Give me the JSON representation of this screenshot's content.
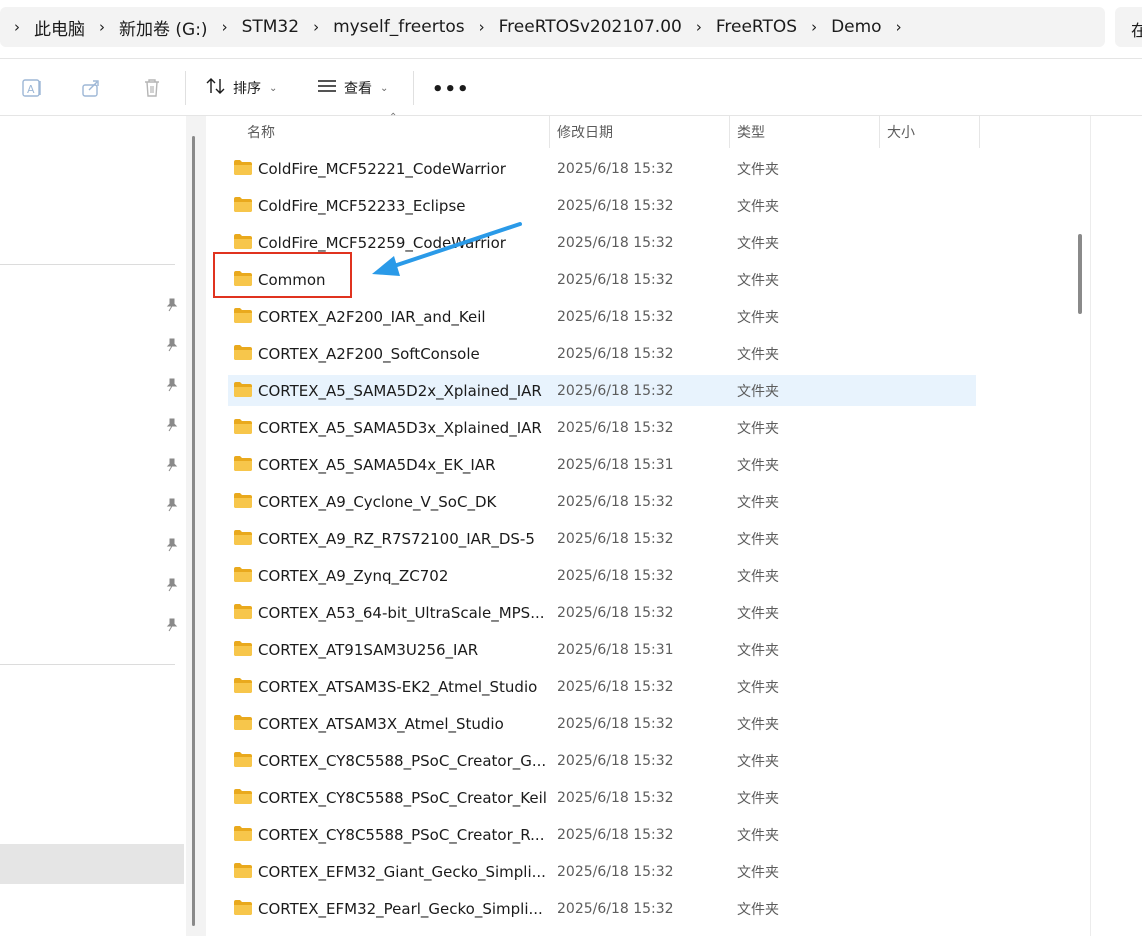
{
  "breadcrumb": {
    "items": [
      "此电脑",
      "新加卷 (G:)",
      "STM32",
      "myself_freertos",
      "FreeRTOSv202107.00",
      "FreeRTOS",
      "Demo"
    ],
    "search_stub": "在"
  },
  "toolbar": {
    "sort_label": "排序",
    "view_label": "查看",
    "more_label": "•••"
  },
  "columns": {
    "name": "名称",
    "date": "修改日期",
    "type": "类型",
    "size": "大小"
  },
  "colors": {
    "selection": "#e8f3fd",
    "highlight": "#e0331f",
    "arrow": "#2a9ae8",
    "folder": "#f7c64b"
  },
  "files": [
    {
      "name": "ColdFire_MCF52221_CodeWarrior",
      "date": "2025/6/18 15:32",
      "type": "文件夹"
    },
    {
      "name": "ColdFire_MCF52233_Eclipse",
      "date": "2025/6/18 15:32",
      "type": "文件夹"
    },
    {
      "name": "ColdFire_MCF52259_CodeWarrior",
      "date": "2025/6/18 15:32",
      "type": "文件夹"
    },
    {
      "name": "Common",
      "date": "2025/6/18 15:32",
      "type": "文件夹"
    },
    {
      "name": "CORTEX_A2F200_IAR_and_Keil",
      "date": "2025/6/18 15:32",
      "type": "文件夹"
    },
    {
      "name": "CORTEX_A2F200_SoftConsole",
      "date": "2025/6/18 15:32",
      "type": "文件夹"
    },
    {
      "name": "CORTEX_A5_SAMA5D2x_Xplained_IAR",
      "date": "2025/6/18 15:32",
      "type": "文件夹"
    },
    {
      "name": "CORTEX_A5_SAMA5D3x_Xplained_IAR",
      "date": "2025/6/18 15:32",
      "type": "文件夹"
    },
    {
      "name": "CORTEX_A5_SAMA5D4x_EK_IAR",
      "date": "2025/6/18 15:31",
      "type": "文件夹"
    },
    {
      "name": "CORTEX_A9_Cyclone_V_SoC_DK",
      "date": "2025/6/18 15:32",
      "type": "文件夹"
    },
    {
      "name": "CORTEX_A9_RZ_R7S72100_IAR_DS-5",
      "date": "2025/6/18 15:32",
      "type": "文件夹"
    },
    {
      "name": "CORTEX_A9_Zynq_ZC702",
      "date": "2025/6/18 15:32",
      "type": "文件夹"
    },
    {
      "name": "CORTEX_A53_64-bit_UltraScale_MPS...",
      "date": "2025/6/18 15:32",
      "type": "文件夹"
    },
    {
      "name": "CORTEX_AT91SAM3U256_IAR",
      "date": "2025/6/18 15:31",
      "type": "文件夹"
    },
    {
      "name": "CORTEX_ATSAM3S-EK2_Atmel_Studio",
      "date": "2025/6/18 15:32",
      "type": "文件夹"
    },
    {
      "name": "CORTEX_ATSAM3X_Atmel_Studio",
      "date": "2025/6/18 15:32",
      "type": "文件夹"
    },
    {
      "name": "CORTEX_CY8C5588_PSoC_Creator_G...",
      "date": "2025/6/18 15:32",
      "type": "文件夹"
    },
    {
      "name": "CORTEX_CY8C5588_PSoC_Creator_Keil",
      "date": "2025/6/18 15:32",
      "type": "文件夹"
    },
    {
      "name": "CORTEX_CY8C5588_PSoC_Creator_R...",
      "date": "2025/6/18 15:32",
      "type": "文件夹"
    },
    {
      "name": "CORTEX_EFM32_Giant_Gecko_Simpli...",
      "date": "2025/6/18 15:32",
      "type": "文件夹"
    },
    {
      "name": "CORTEX_EFM32_Pearl_Gecko_Simpli...",
      "date": "2025/6/18 15:32",
      "type": "文件夹"
    }
  ]
}
